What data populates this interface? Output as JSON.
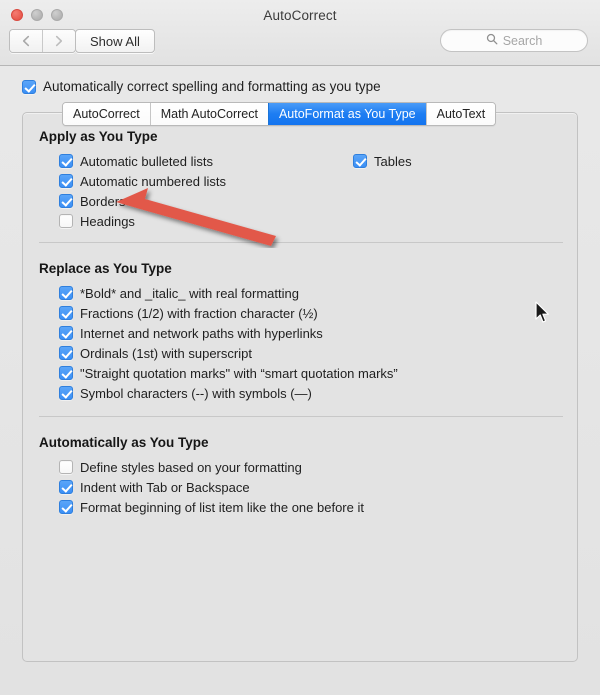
{
  "window": {
    "title": "AutoCorrect",
    "traffic_lights": [
      "close",
      "minimize",
      "zoom"
    ],
    "accent_blue": "#3b8ff5",
    "selected_tab_blue": "#1d7df2",
    "annotation_red": "#e2584a"
  },
  "toolbar": {
    "back_icon": "chevron-left-icon",
    "forward_icon": "chevron-right-icon",
    "show_all_label": "Show All",
    "search": {
      "placeholder": "Search",
      "icon": "search-icon",
      "value": ""
    }
  },
  "master_checkbox": {
    "label": "Automatically correct spelling and formatting as you type",
    "checked": true
  },
  "tabs": [
    {
      "label": "AutoCorrect",
      "selected": false
    },
    {
      "label": "Math AutoCorrect",
      "selected": false
    },
    {
      "label": "AutoFormat as You Type",
      "selected": true
    },
    {
      "label": "AutoText",
      "selected": false
    }
  ],
  "sections": [
    {
      "title": "Apply as You Type",
      "items": [
        {
          "label": "Automatic bulleted lists",
          "checked": true
        },
        {
          "label": "Automatic numbered lists",
          "checked": true
        },
        {
          "label": "Borders",
          "checked": true
        },
        {
          "label": "Headings",
          "checked": false
        }
      ],
      "right_items": [
        {
          "label": "Tables",
          "checked": true
        }
      ]
    },
    {
      "title": "Replace as You Type",
      "items": [
        {
          "label": "*Bold* and _italic_ with real formatting",
          "checked": true
        },
        {
          "label": "Fractions (1/2) with fraction character (½)",
          "checked": true
        },
        {
          "label": "Internet and network paths with hyperlinks",
          "checked": true
        },
        {
          "label": "Ordinals (1st) with superscript",
          "checked": true
        },
        {
          "label": "\"Straight quotation marks\" with “smart quotation marks”",
          "checked": true
        },
        {
          "label": "Symbol characters (--) with symbols (—)",
          "checked": true
        }
      ],
      "right_items": []
    },
    {
      "title": "Automatically as You Type",
      "items": [
        {
          "label": "Define styles based on your formatting",
          "checked": false
        },
        {
          "label": "Indent with Tab or Backspace",
          "checked": true
        },
        {
          "label": "Format beginning of list item like the one before it",
          "checked": true
        }
      ],
      "right_items": []
    }
  ],
  "annotations": {
    "arrow": {
      "name": "red-arrow-annotation",
      "points_to": "Borders"
    },
    "cursor": {
      "name": "mouse-cursor"
    }
  }
}
